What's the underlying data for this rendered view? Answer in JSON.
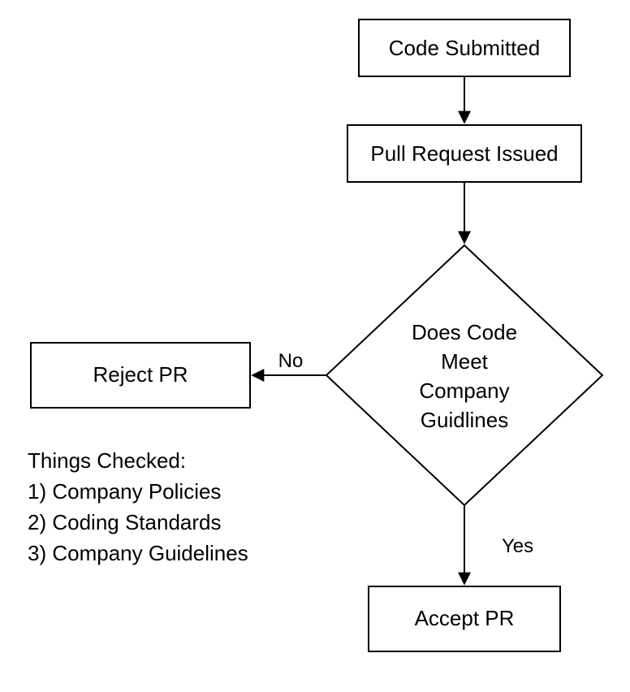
{
  "nodes": {
    "submitted": "Code Submitted",
    "issued": "Pull Request Issued",
    "decision_l1": "Does Code",
    "decision_l2": "Meet",
    "decision_l3": "Company",
    "decision_l4": "Guidlines",
    "reject": "Reject PR",
    "accept": "Accept PR"
  },
  "edges": {
    "no": "No",
    "yes": "Yes"
  },
  "notes": {
    "heading": "Things Checked:",
    "item1": "1) Company Policies",
    "item2": "2) Coding Standards",
    "item3": "3) Company Guidelines"
  },
  "chart_data": {
    "type": "flowchart",
    "nodes": [
      {
        "id": "submitted",
        "kind": "process",
        "label": "Code Submitted"
      },
      {
        "id": "issued",
        "kind": "process",
        "label": "Pull Request Issued"
      },
      {
        "id": "decision",
        "kind": "decision",
        "label": "Does Code Meet Company Guidlines"
      },
      {
        "id": "reject",
        "kind": "process",
        "label": "Reject PR"
      },
      {
        "id": "accept",
        "kind": "process",
        "label": "Accept PR"
      }
    ],
    "edges": [
      {
        "from": "submitted",
        "to": "issued",
        "label": ""
      },
      {
        "from": "issued",
        "to": "decision",
        "label": ""
      },
      {
        "from": "decision",
        "to": "reject",
        "label": "No"
      },
      {
        "from": "decision",
        "to": "accept",
        "label": "Yes"
      }
    ],
    "annotations": [
      "Things Checked:",
      "1) Company Policies",
      "2) Coding Standards",
      "3) Company Guidelines"
    ]
  }
}
